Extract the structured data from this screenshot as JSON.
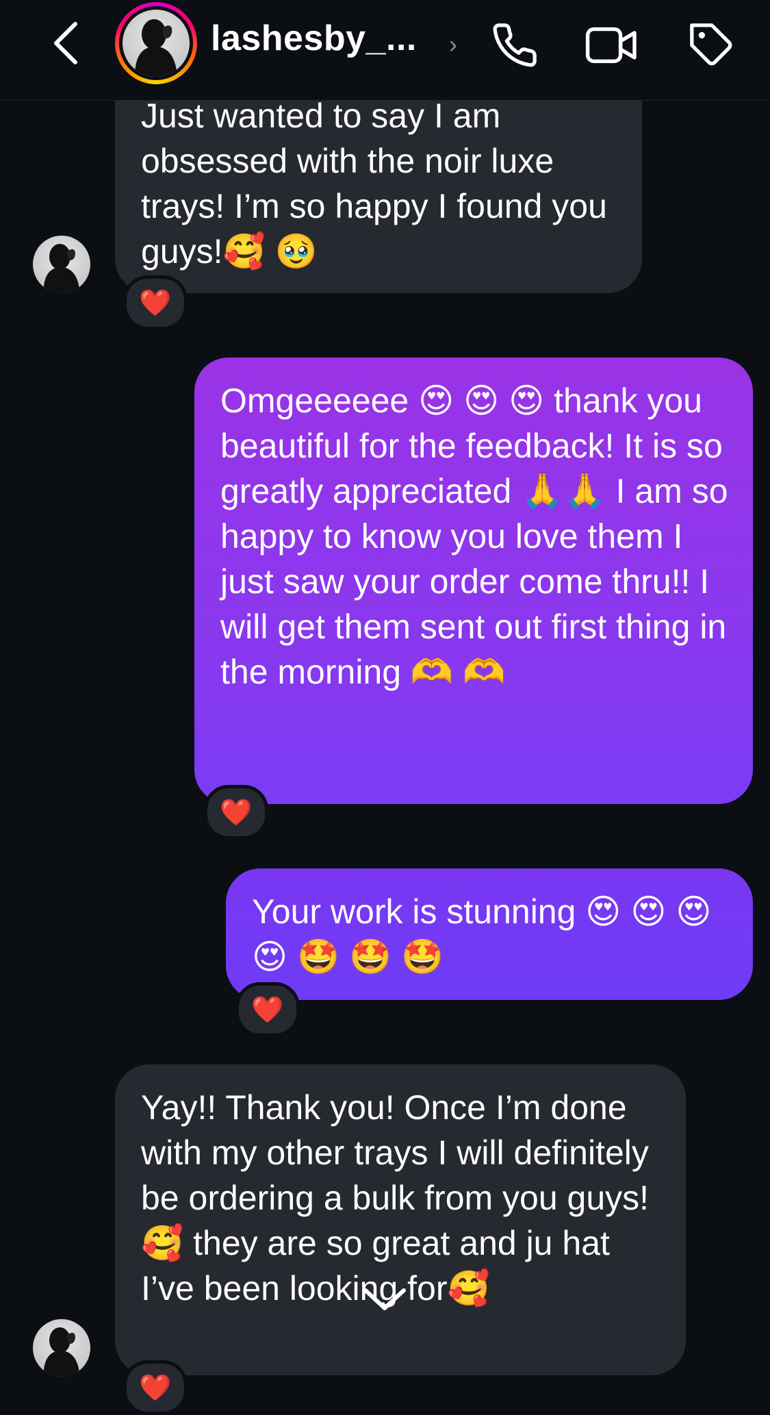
{
  "header": {
    "back_icon": "chevron-left-icon",
    "username": "lashesby_...",
    "username_chevron": "›",
    "call_icon": "phone-icon",
    "video_icon": "video-camera-icon",
    "tag_icon": "tag-icon"
  },
  "messages": [
    {
      "direction": "incoming",
      "text": "Just wanted to say I am obsessed with the noir luxe trays! I’m so happy I found you guys!🥰 🥹",
      "reaction": "❤️"
    },
    {
      "direction": "outgoing",
      "text": "Omgeeeeee 😍 😍 😍  thank you beautiful for the feedback! It is so greatly appreciated 🙏🙏  I am so happy to know you love them I just saw your order come thru!! I will get them sent out first thing in the morning 🫶 🫶",
      "reaction": "❤️"
    },
    {
      "direction": "outgoing",
      "text": "Your work is stunning 😍 😍 😍 😍 🤩 🤩 🤩",
      "reaction": "❤️"
    },
    {
      "direction": "incoming",
      "text": "Yay!! Thank you! Once I’m done with my other trays I will definitely be ordering a bulk from you guys!🥰  they are so great and ju   hat I’ve been looking for🥰",
      "reaction": "❤️"
    }
  ],
  "colors": {
    "background": "#0b0e13",
    "incoming_bubble": "#26292f",
    "outgoing_gradient_top": "#9a33e6",
    "outgoing_gradient_bottom": "#7b3bf5"
  },
  "scroll_down_icon": "chevron-down-icon"
}
